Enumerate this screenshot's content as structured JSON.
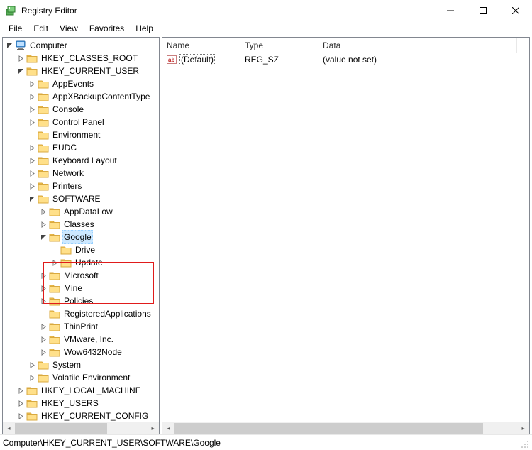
{
  "window": {
    "title": "Registry Editor"
  },
  "menu": {
    "file": "File",
    "edit": "Edit",
    "view": "View",
    "favorites": "Favorites",
    "help": "Help"
  },
  "tree": {
    "root": "Computer",
    "hives": {
      "classes_root": "HKEY_CLASSES_ROOT",
      "current_user": "HKEY_CURRENT_USER",
      "local_machine": "HKEY_LOCAL_MACHINE",
      "users": "HKEY_USERS",
      "current_config": "HKEY_CURRENT_CONFIG"
    },
    "hkcu_children": {
      "appevents": "AppEvents",
      "appxbackup": "AppXBackupContentType",
      "console": "Console",
      "controlpanel": "Control Panel",
      "environment": "Environment",
      "eudc": "EUDC",
      "keyboard": "Keyboard Layout",
      "network": "Network",
      "printers": "Printers",
      "software": "SOFTWARE",
      "system": "System",
      "volatile": "Volatile Environment"
    },
    "software_children": {
      "appdatalow": "AppDataLow",
      "classes": "Classes",
      "google": "Google",
      "microsoft": "Microsoft",
      "mine": "Mine",
      "policies": "Policies",
      "regapps": "RegisteredApplications",
      "thinprint": "ThinPrint",
      "vmware": "VMware, Inc.",
      "wow64": "Wow6432Node"
    },
    "google_children": {
      "drive": "Drive",
      "update": "Update"
    }
  },
  "list": {
    "columns": {
      "name": "Name",
      "type": "Type",
      "data": "Data"
    },
    "rows": [
      {
        "name": "(Default)",
        "type": "REG_SZ",
        "data": "(value not set)"
      }
    ]
  },
  "statusbar": {
    "path": "Computer\\HKEY_CURRENT_USER\\SOFTWARE\\Google"
  },
  "col_widths": {
    "name": 110,
    "type": 110,
    "data": 280
  }
}
